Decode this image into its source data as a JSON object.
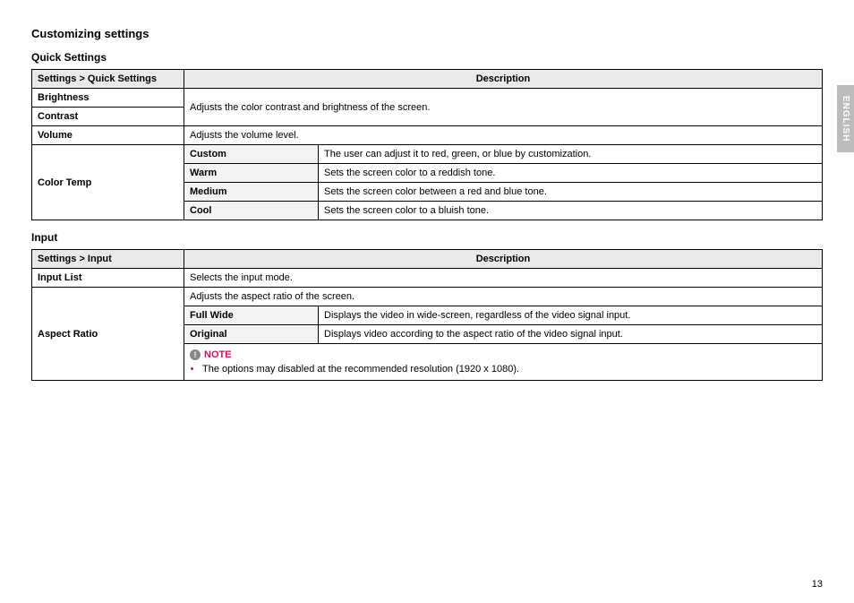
{
  "sideTab": "ENGLISH",
  "pageNumber": "13",
  "title": "Customizing settings",
  "quick": {
    "heading": "Quick Settings",
    "col1": "Settings > Quick Settings",
    "col2": "Description",
    "brightness": "Brightness",
    "contrast": "Contrast",
    "brightContrastDesc": "Adjusts the color contrast and brightness of the screen.",
    "volume": "Volume",
    "volumeDesc": "Adjusts the volume level.",
    "colorTemp": "Color Temp",
    "ct": {
      "custom": {
        "label": "Custom",
        "desc": "The user can adjust it to red, green, or blue by customization."
      },
      "warm": {
        "label": "Warm",
        "desc": "Sets the screen color to a reddish tone."
      },
      "medium": {
        "label": "Medium",
        "desc": "Sets the screen color between a red and blue tone."
      },
      "cool": {
        "label": "Cool",
        "desc": "Sets the screen color to a bluish tone."
      }
    }
  },
  "input": {
    "heading": "Input",
    "col1": "Settings > Input",
    "col2": "Description",
    "inputList": "Input List",
    "inputListDesc": "Selects the input mode.",
    "aspectRatio": "Aspect Ratio",
    "aspectDesc": "Adjusts the aspect ratio of the screen.",
    "fullWide": {
      "label": "Full Wide",
      "desc": "Displays the video in wide-screen, regardless of the video signal input."
    },
    "original": {
      "label": "Original",
      "desc": "Displays video according to the aspect ratio of the video signal input."
    },
    "noteLabel": "NOTE",
    "noteText": "The options may disabled at the recommended resolution (1920 x 1080)."
  }
}
